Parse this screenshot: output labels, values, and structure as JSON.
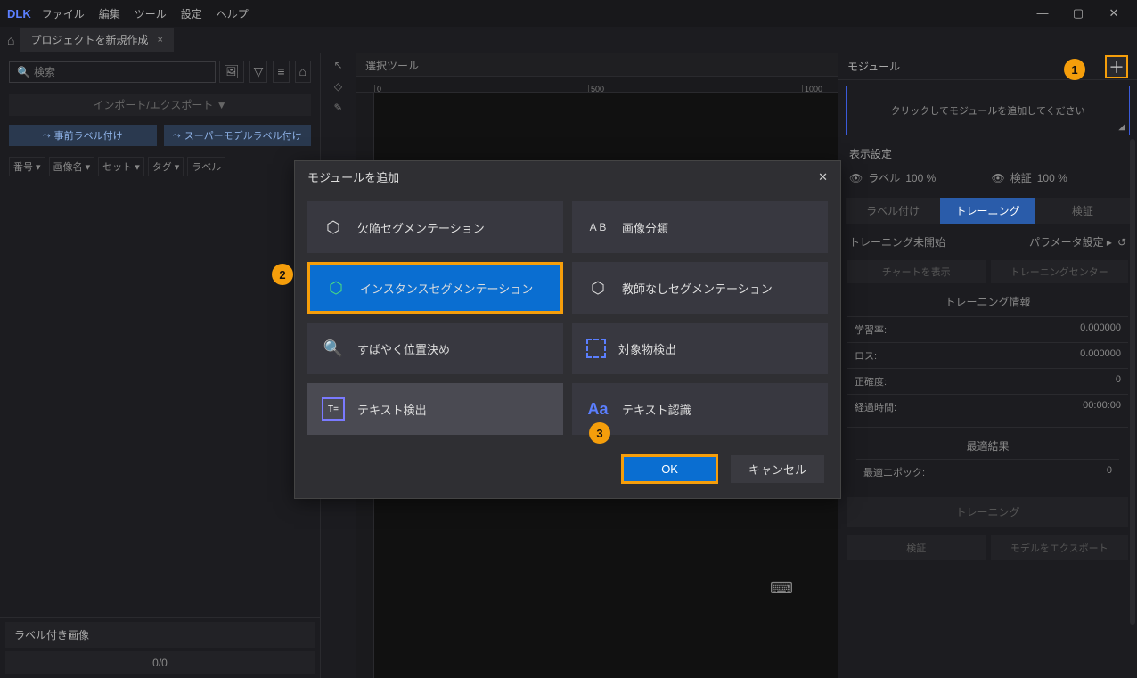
{
  "app": {
    "logo": "DLK"
  },
  "menu": {
    "file": "ファイル",
    "edit": "編集",
    "tool": "ツール",
    "settings": "設定",
    "help": "ヘルプ"
  },
  "tab": {
    "title": "プロジェクトを新規作成"
  },
  "left": {
    "search_placeholder": "検索",
    "import_export": "インポート/エクスポート ▼",
    "prelabel": "事前ラベル付け",
    "supermodel": "スーパーモデルラベル付け",
    "cols": {
      "num": "番号 ▾",
      "imgname": "画像名 ▾",
      "set": "セット ▾",
      "tag": "タグ ▾",
      "label": "ラベル"
    },
    "labeled_tab": "ラベル付き画像",
    "pager": "0/0"
  },
  "canvas": {
    "tool_label": "選択ツール",
    "tick0": "0",
    "tick500": "500",
    "tick1000": "1000"
  },
  "right": {
    "module_header": "モジュール",
    "add_hint": "クリックしてモジュールを追加してください",
    "display_settings": "表示設定",
    "label_vis": "ラベル",
    "label_pct": "100 %",
    "verify_vis": "検証",
    "verify_pct": "100 %",
    "tab_label": "ラベル付け",
    "tab_train": "トレーニング",
    "tab_verify": "検証",
    "train_status": "トレーニング未開始",
    "param_set": "パラメータ設定 ▸",
    "chart_btn": "チャートを表示",
    "center_btn": "トレーニングセンター",
    "info_title": "トレーニング情報",
    "lr": "学習率:",
    "lr_v": "0.000000",
    "loss": "ロス:",
    "loss_v": "0.000000",
    "acc": "正確度:",
    "acc_v": "0",
    "elapsed": "経過時間:",
    "elapsed_v": "00:00:00",
    "best_title": "最適結果",
    "best_epoch": "最適エポック:",
    "best_epoch_v": "0",
    "train_btn": "トレーニング",
    "verify_btn": "検証",
    "export_btn": "モデルをエクスポート"
  },
  "modal": {
    "title": "モジュールを追加",
    "defect_seg": "欠陥セグメンテーション",
    "image_cls": "画像分類",
    "instance_seg": "インスタンスセグメンテーション",
    "unsup_seg": "教師なしセグメンテーション",
    "fast_locate": "すばやく位置決め",
    "obj_det": "対象物検出",
    "text_det": "テキスト検出",
    "text_rec": "テキスト認識",
    "ok": "OK",
    "cancel": "キャンセル"
  },
  "callouts": {
    "c1": "1",
    "c2": "2",
    "c3": "3"
  }
}
